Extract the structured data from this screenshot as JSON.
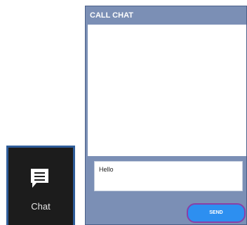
{
  "launcher": {
    "chat_label": "Chat",
    "icon": "chat-bubble-icon"
  },
  "chat_panel": {
    "title": "CALL CHAT",
    "input_value": "Hello",
    "send_label": "SEND"
  },
  "colors": {
    "panel_bg": "#7b8fb5",
    "send_button": "#2d8ff0",
    "tile_bg": "#1c1c1c",
    "tile_border": "#2f5d9a",
    "highlight_ring": "#8a3fa6"
  }
}
